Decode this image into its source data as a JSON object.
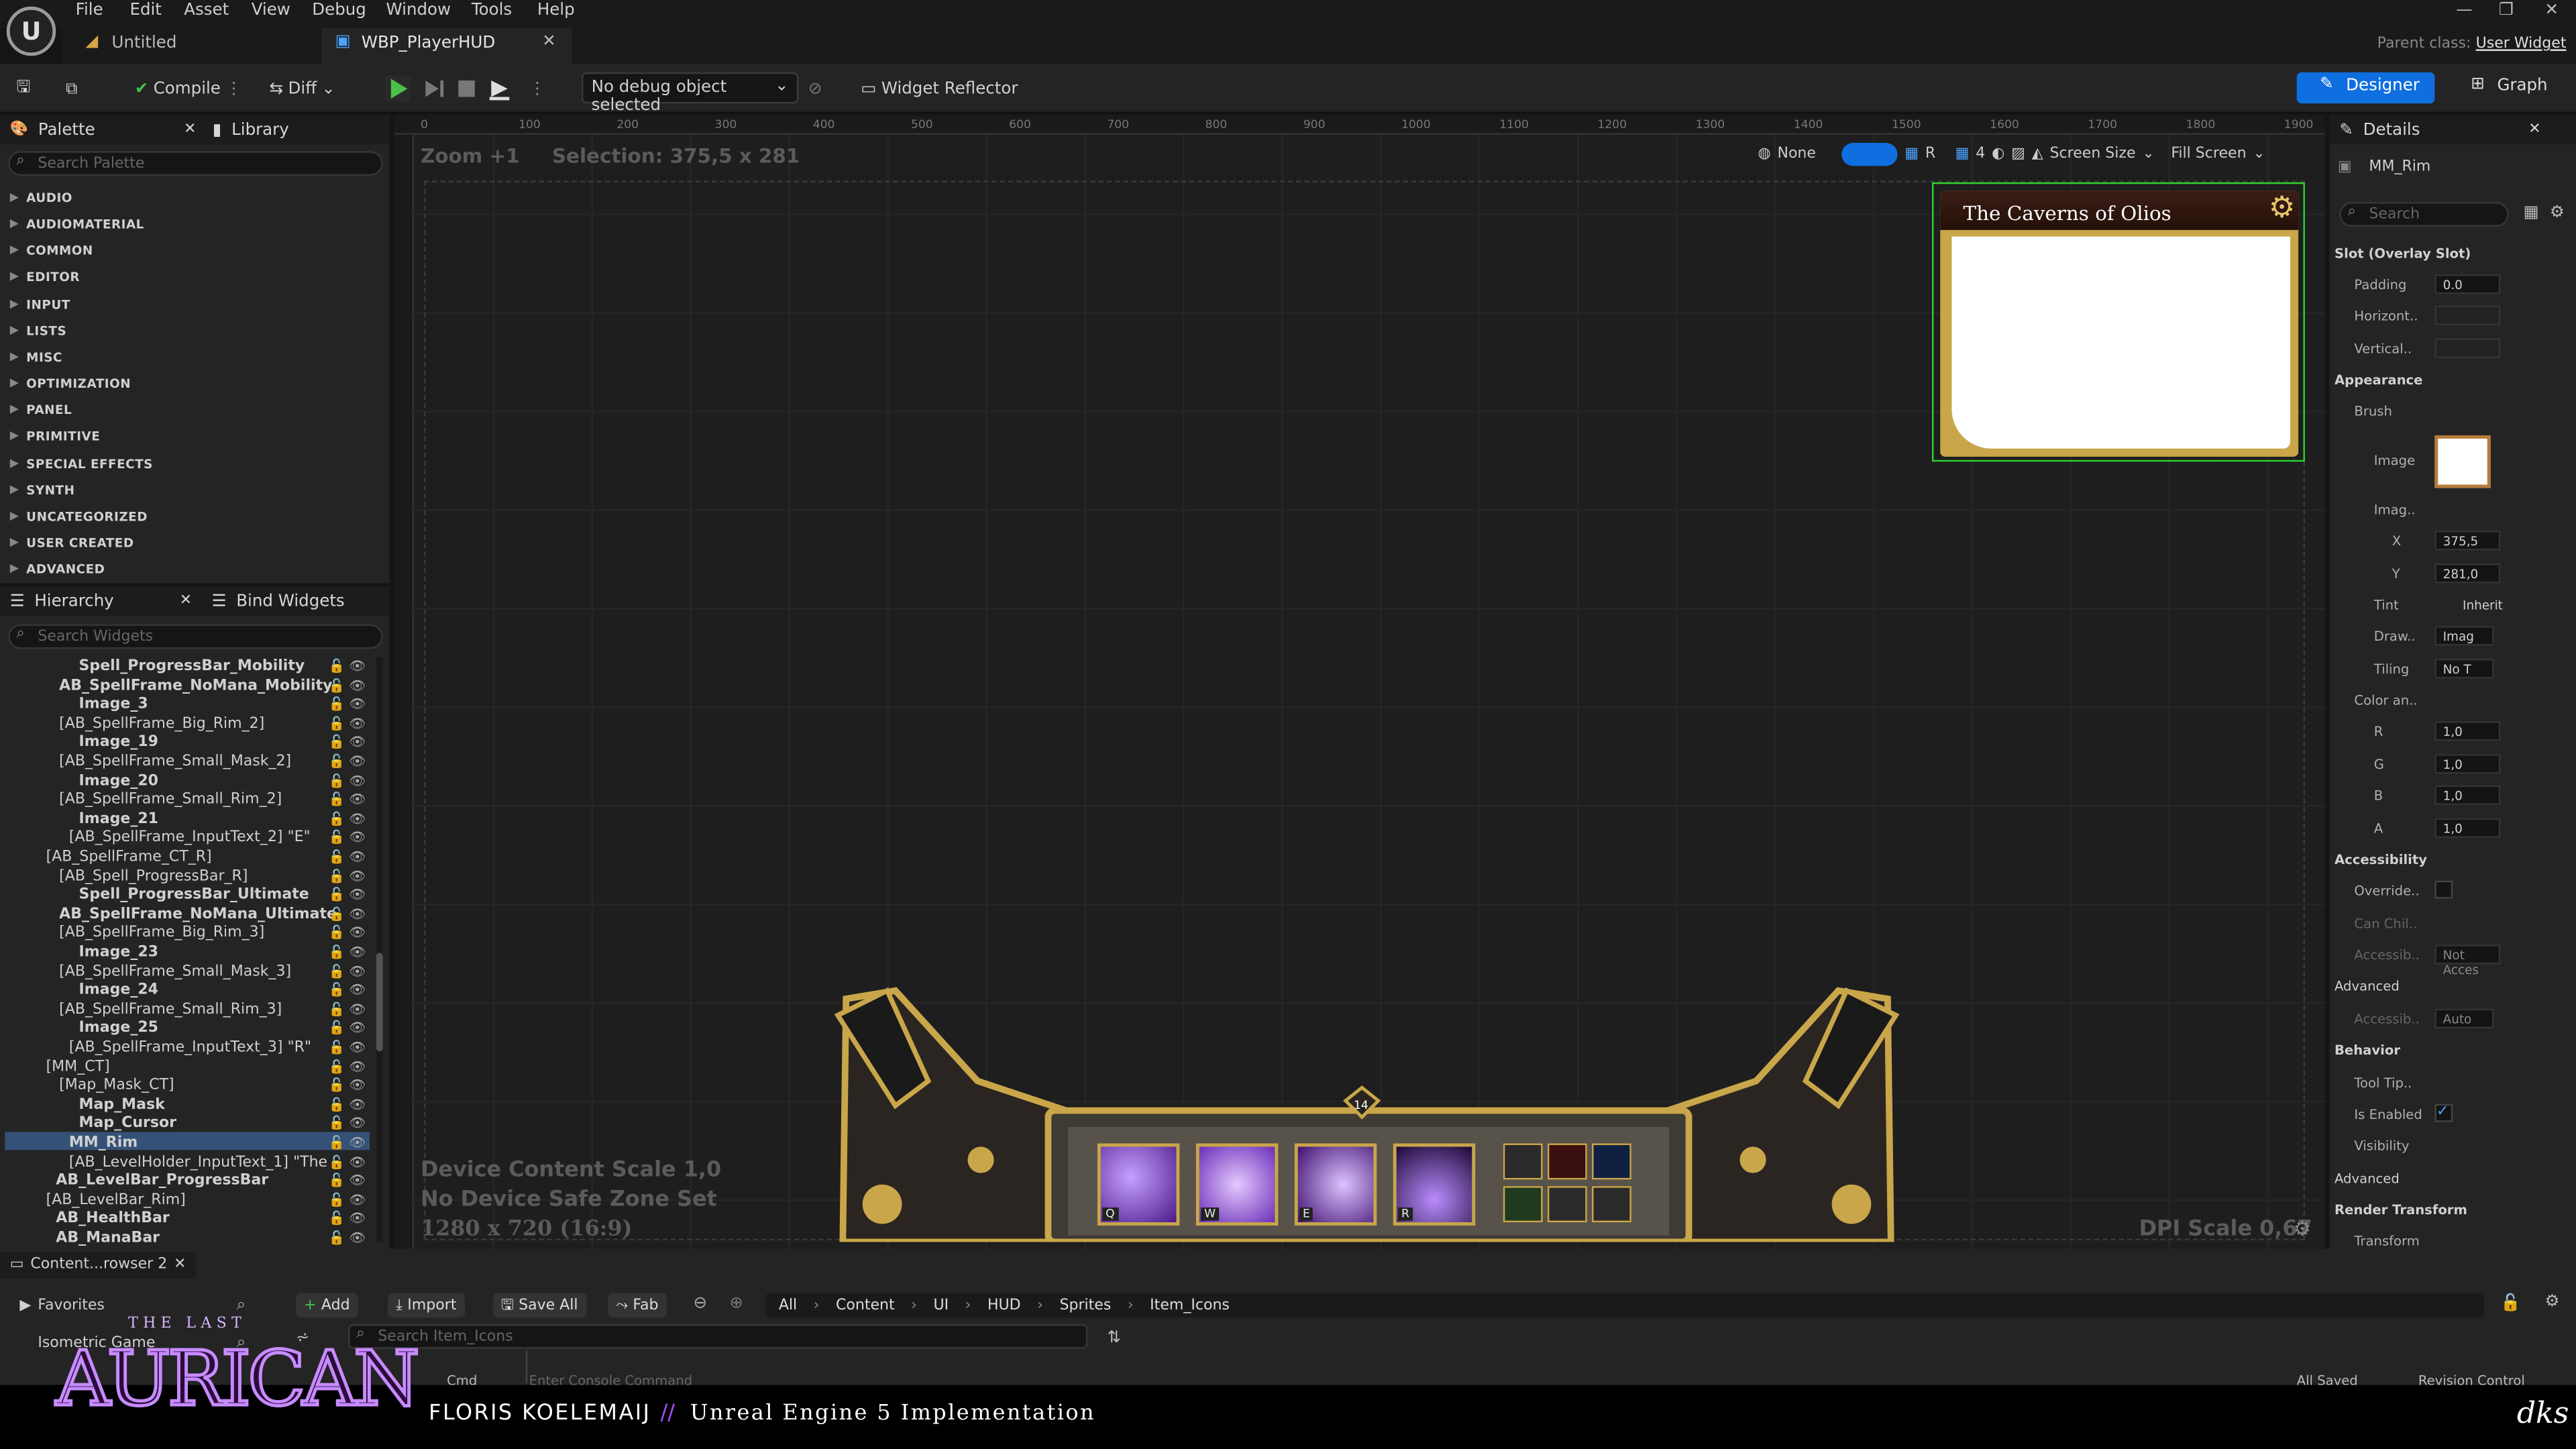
{
  "menu": [
    "File",
    "Edit",
    "Asset",
    "View",
    "Debug",
    "Window",
    "Tools",
    "Help"
  ],
  "tabs": {
    "untitled": "Untitled",
    "wbp": "WBP_PlayerHUD",
    "parent_label": "Parent class:",
    "parent_value": "User Widget"
  },
  "toolbar": {
    "compile": "Compile",
    "diff": "Diff",
    "debug_object": "No debug object selected",
    "reflector": "Widget Reflector",
    "designer": "Designer",
    "graph": "Graph"
  },
  "palette": {
    "title": "Palette",
    "library": "Library",
    "search_placeholder": "Search Palette",
    "categories": [
      "AUDIO",
      "AUDIOMATERIAL",
      "COMMON",
      "EDITOR",
      "INPUT",
      "LISTS",
      "MISC",
      "OPTIMIZATION",
      "PANEL",
      "PRIMITIVE",
      "SPECIAL EFFECTS",
      "SYNTH",
      "UNCATEGORIZED",
      "USER CREATED",
      "ADVANCED"
    ]
  },
  "hierarchy": {
    "title": "Hierarchy",
    "bind": "Bind Widgets",
    "search_placeholder": "Search Widgets",
    "items": [
      "Spell_ProgressBar_Mobility",
      "AB_SpellFrame_NoMana_Mobility",
      "Image_3",
      "[AB_SpellFrame_Big_Rim_2]",
      "Image_19",
      "[AB_SpellFrame_Small_Mask_2]",
      "Image_20",
      "[AB_SpellFrame_Small_Rim_2]",
      "Image_21",
      "[AB_SpellFrame_InputText_2] \"E\"",
      "[AB_SpellFrame_CT_R]",
      "[AB_Spell_ProgressBar_R]",
      "Spell_ProgressBar_Ultimate",
      "AB_SpellFrame_NoMana_Ultimate",
      "[AB_SpellFrame_Big_Rim_3]",
      "Image_23",
      "[AB_SpellFrame_Small_Mask_3]",
      "Image_24",
      "[AB_SpellFrame_Small_Rim_3]",
      "Image_25",
      "[AB_SpellFrame_InputText_3] \"R\"",
      "[MM_CT]",
      "[Map_Mask_CT]",
      "Map_Mask",
      "Map_Cursor",
      "MM_Rim",
      "[AB_LevelHolder_InputText_1] \"The",
      "AB_LevelBar_ProgressBar",
      "[AB_LevelBar_Rim]",
      "AB_HealthBar",
      "AB_ManaBar"
    ]
  },
  "canvas": {
    "zoom": "Zoom +1",
    "selection": "Selection: 375,5 x 281",
    "none": "None",
    "r": "R",
    "grid_count": "4",
    "screen_size": "Screen Size",
    "fill_screen": "Fill Screen",
    "ruler": [
      "0",
      "100",
      "200",
      "300",
      "400",
      "500",
      "600",
      "700",
      "800",
      "900",
      "1000",
      "1100",
      "1200",
      "1300",
      "1400",
      "1500",
      "1600",
      "1700",
      "1800",
      "1900"
    ],
    "dcs": "Device Content Scale 1,0",
    "safe": "No Device Safe Zone Set",
    "res": "1280 x 720 (16:9)",
    "dpi": "DPI Scale 0,67",
    "minimap_title": "The Caverns of Olios",
    "level": "14",
    "keys": [
      "Q",
      "W",
      "E",
      "R"
    ]
  },
  "details": {
    "title": "Details",
    "widget": "MM_Rim",
    "search_placeholder": "Search",
    "sections": {
      "slot": "Slot (Overlay Slot)",
      "appearance": "Appearance",
      "accessibility": "Accessibility",
      "advanced": "Advanced",
      "behavior": "Behavior",
      "advanced2": "Advanced",
      "render": "Render Transform"
    },
    "labels": {
      "padding": "Padding",
      "horizontal": "Horizont..",
      "vertical": "Vertical..",
      "brush": "Brush",
      "image": "Image",
      "imagesize": "Imag..",
      "x": "X",
      "y": "Y",
      "tint": "Tint",
      "draw": "Draw..",
      "tiling": "Tiling",
      "color": "Color an..",
      "r": "R",
      "g": "G",
      "b": "B",
      "a": "A",
      "override": "Override..",
      "canchild": "Can Chil..",
      "accessib": "Accessib..",
      "advanced": "Advanced",
      "accessib2": "Accessib..",
      "tooltip": "Tool Tip..",
      "enabled": "Is Enabled",
      "visibility": "Visibility",
      "transform": "Transform"
    },
    "values": {
      "padding": "0.0",
      "x": "375,5",
      "y": "281,0",
      "tint": "Inherit",
      "draw": "Imag",
      "tiling": "No T",
      "r": "1,0",
      "g": "1,0",
      "b": "1,0",
      "a": "1,0",
      "accessib": "Not Acces",
      "auto": "Auto"
    }
  },
  "content": {
    "tab": "Content...rowser 2",
    "favorites": "Favorites",
    "isometric": "Isometric Game",
    "add": "Add",
    "import": "Import",
    "save_all": "Save All",
    "fab": "Fab",
    "path": [
      "All",
      "Content",
      "UI",
      "HUD",
      "Sprites",
      "Item_Icons"
    ],
    "search_placeholder": "Search Item_Icons",
    "cmd": "Cmd",
    "console_placeholder": "Enter Console Command",
    "all_saved": "All Saved",
    "revision": "Revision Control"
  },
  "footer": {
    "game_small": "THE LAST",
    "game_logo": "AURICAN",
    "author": "FLORIS KOELEMAIJ",
    "sep": "//",
    "subtitle": "Unreal Engine 5 Implementation",
    "mark": "dks"
  },
  "colors": {
    "accent": "#0f6fe0",
    "gold": "#c9a64a",
    "purple": "#7a2fc8",
    "selection": "#2fd12f"
  }
}
